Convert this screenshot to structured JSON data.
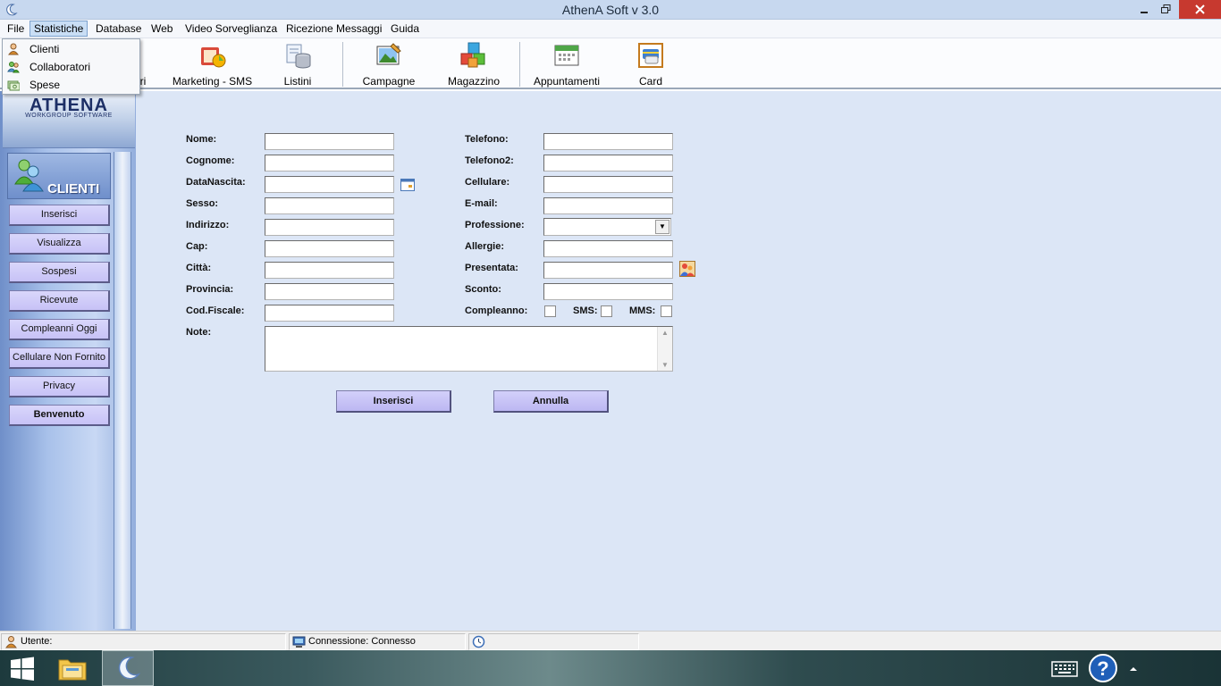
{
  "window": {
    "title": "AthenA Soft v 3.0"
  },
  "menubar": {
    "items": [
      "File",
      "Statistiche",
      "Database",
      "Web",
      "Video Sorveglianza",
      "Ricezione Messaggi",
      "Guida"
    ],
    "active": "Statistiche"
  },
  "statistiche_menu": {
    "items": [
      {
        "label": "Clienti",
        "icon": "person-icon"
      },
      {
        "label": "Collaboratori",
        "icon": "people-icon"
      },
      {
        "label": "Spese",
        "icon": "money-icon"
      }
    ]
  },
  "toolbar": {
    "items": [
      {
        "label": "Collaboratori",
        "visible_label": "atori",
        "icon": "people-icon"
      },
      {
        "label": "Marketing - SMS",
        "icon": "marketing-icon"
      },
      {
        "label": "Listini",
        "icon": "database-icon"
      },
      {
        "label": "Campagne",
        "icon": "picture-icon"
      },
      {
        "label": "Magazzino",
        "icon": "boxes-icon"
      },
      {
        "label": "Appuntamenti",
        "icon": "calendar-icon"
      },
      {
        "label": "Card",
        "icon": "card-icon"
      }
    ]
  },
  "sidebar": {
    "logo": {
      "name": "ATHENA",
      "tagline": "WORKGROUP SOFTWARE"
    },
    "panel_title": "CLIENTI",
    "buttons": [
      "Inserisci",
      "Visualizza",
      "Sospesi",
      "Ricevute",
      "Compleanni Oggi",
      "Cellulare Non Fornito",
      "Privacy",
      "Benvenuto"
    ]
  },
  "form": {
    "left": {
      "nome": "Nome:",
      "cognome": "Cognome:",
      "datanascita": "DataNascita:",
      "sesso": "Sesso:",
      "indirizzo": "Indirizzo:",
      "cap": "Cap:",
      "citta": "Città:",
      "provincia": "Provincia:",
      "codfiscale": "Cod.Fiscale:",
      "note": "Note:"
    },
    "right": {
      "telefono": "Telefono:",
      "telefono2": "Telefono2:",
      "cellulare": "Cellulare:",
      "email": "E-mail:",
      "professione": "Professione:",
      "allergie": "Allergie:",
      "presentata": "Presentata:",
      "sconto": "Sconto:",
      "compleanno": "Compleanno:",
      "sms": "SMS:",
      "mms": "MMS:"
    },
    "values": {
      "nome": "",
      "cognome": "",
      "datanascita": "",
      "sesso": "",
      "indirizzo": "",
      "cap": "",
      "citta": "",
      "provincia": "",
      "codfiscale": "",
      "note": "",
      "telefono": "",
      "telefono2": "",
      "cellulare": "",
      "email": "",
      "professione": "",
      "allergie": "",
      "presentata": "",
      "sconto": ""
    },
    "checks": {
      "compleanno": false,
      "sms": false,
      "mms": false
    },
    "buttons": {
      "submit": "Inserisci",
      "cancel": "Annulla"
    }
  },
  "statusbar": {
    "utente": "Utente:",
    "connessione": "Connessione: Connesso"
  },
  "colors": {
    "content_bg": "#dce6f6",
    "button_bg": "#c7c2f6",
    "titlebar": "#c7d8ef",
    "close_button": "#c7392f"
  }
}
